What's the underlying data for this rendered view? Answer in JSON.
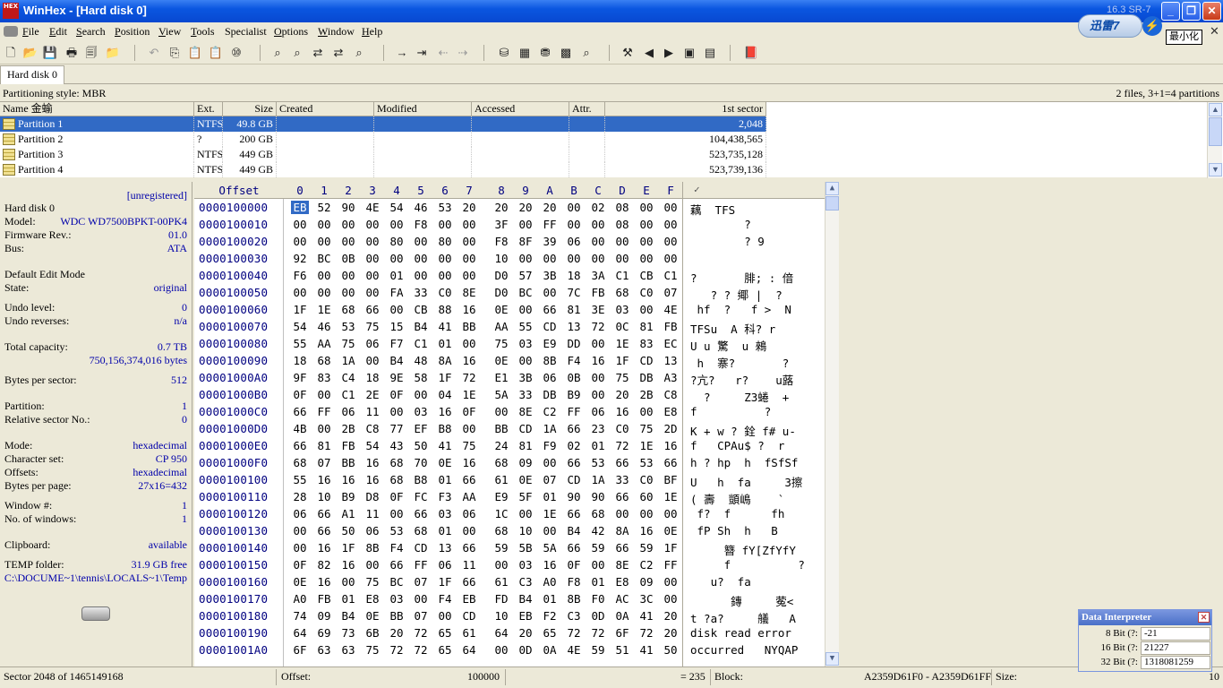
{
  "titlebar": {
    "logo": "HEX",
    "title": "WinHex - [Hard disk 0]",
    "version": "16.3 SR-7",
    "minimize": "_",
    "restore": "❐",
    "close": "✕"
  },
  "overlay": {
    "xunlei_label": "迅雷7",
    "xunlei_bolt": "⚡",
    "tooltip": "最小化",
    "doc_close": "✕"
  },
  "menu": {
    "items": [
      {
        "key": "F",
        "rest": "ile"
      },
      {
        "key": "E",
        "rest": "dit"
      },
      {
        "key": "S",
        "rest": "earch"
      },
      {
        "key": "P",
        "rest": "osition"
      },
      {
        "key": "V",
        "rest": "iew"
      },
      {
        "key": "T",
        "rest": "ools"
      },
      {
        "key": "",
        "rest": "Specialist"
      },
      {
        "key": "O",
        "rest": "ptions"
      },
      {
        "key": "W",
        "rest": "indow"
      },
      {
        "key": "H",
        "rest": "elp"
      }
    ]
  },
  "toolbar": {
    "icons": [
      "new-file-icon",
      "open-folder-icon",
      "save-icon",
      "print-icon",
      "properties-icon",
      "open-disk-icon",
      "undo-icon",
      "copy-icon",
      "paste-icon",
      "paste-special-icon",
      "hex-convert-icon",
      "find-icon",
      "find-hex-icon",
      "replace-icon",
      "replace-hex-icon",
      "find-again-icon",
      "goto-offset-icon",
      "goto-sector-icon",
      "back-icon",
      "forward-icon",
      "disk-editor-icon",
      "ram-editor-icon",
      "hdd-icon",
      "calculator-icon",
      "analyze-icon",
      "tools-icon",
      "prev-sector-icon",
      "next-sector-icon",
      "snapshot-icon",
      "template-icon",
      "help-book-icon"
    ],
    "glyphs": [
      "🗋",
      "📂",
      "💾",
      "🖶",
      "🗐",
      "📁",
      "↶",
      "⎘",
      "📋",
      "📋",
      "⑩",
      "⌕",
      "⌕",
      "⇄",
      "⇄",
      "⌕",
      "→",
      "⇥",
      "⇠",
      "⇢",
      "⛁",
      "▦",
      "⛃",
      "▩",
      "⌕",
      "⚒",
      "◀",
      "▶",
      "▣",
      "▤",
      "📕"
    ]
  },
  "tab": {
    "label": "Hard disk 0"
  },
  "infobar": {
    "partitioning_style": "Partitioning style: MBR",
    "files_count": "2 files, 3+1=4 partitions"
  },
  "partitions": {
    "headers": {
      "name": "Name 金蝓",
      "ext": "Ext.",
      "size": "Size",
      "created": "Created",
      "modified": "Modified",
      "accessed": "Accessed",
      "attr": "Attr.",
      "first_sector": "1st sector"
    },
    "rows": [
      {
        "name": "Partition 1",
        "ext": "NTFS",
        "size": "49.8 GB",
        "first_sector": "2,048"
      },
      {
        "name": "Partition 2",
        "ext": "?",
        "size": "200 GB",
        "first_sector": "104,438,565"
      },
      {
        "name": "Partition 3",
        "ext": "NTFS",
        "size": "449 GB",
        "first_sector": "523,735,128"
      },
      {
        "name": "Partition 4",
        "ext": "NTFS",
        "size": "449 GB",
        "first_sector": "523,739,136"
      }
    ]
  },
  "info": {
    "unregistered": "[unregistered]",
    "disk_name": "Hard disk 0",
    "model_label": "Model:",
    "model": "WDC WD7500BPKT-00PK4",
    "firmware_label": "Firmware Rev.:",
    "firmware": "01.0",
    "bus_label": "Bus:",
    "bus": "ATA",
    "edit_mode": "Default Edit Mode",
    "state_label": "State:",
    "state": "original",
    "undo_level_label": "Undo level:",
    "undo_level": "0",
    "undo_reverses_label": "Undo reverses:",
    "undo_reverses": "n/a",
    "total_capacity_label": "Total capacity:",
    "total_capacity": "0.7 TB",
    "total_bytes": "750,156,374,016 bytes",
    "bytes_per_sector_label": "Bytes per sector:",
    "bytes_per_sector": "512",
    "partition_label": "Partition:",
    "partition": "1",
    "relative_sector_label": "Relative sector No.:",
    "relative_sector": "0",
    "mode_label": "Mode:",
    "mode": "hexadecimal",
    "charset_label": "Character set:",
    "charset": "CP 950",
    "offsets_label": "Offsets:",
    "offsets": "hexadecimal",
    "bytes_per_page_label": "Bytes per page:",
    "bytes_per_page": "27x16=432",
    "window_no_label": "Window #:",
    "window_no": "1",
    "no_windows_label": "No. of windows:",
    "no_windows": "1",
    "clipboard_label": "Clipboard:",
    "clipboard": "available",
    "temp_folder_label": "TEMP folder:",
    "temp_free": "31.9 GB free",
    "temp_path": "C:\\DOCUME~1\\tennis\\LOCALS~1\\Temp"
  },
  "hex": {
    "offset_label": "Offset",
    "columns": [
      "0",
      "1",
      "2",
      "3",
      "4",
      "5",
      "6",
      "7",
      "8",
      "9",
      "A",
      "B",
      "C",
      "D",
      "E",
      "F"
    ],
    "text_header": "✓",
    "rows": [
      {
        "offset": "0000100000",
        "bytes": [
          "EB",
          "52",
          "90",
          "4E",
          "54",
          "46",
          "53",
          "20",
          "20",
          "20",
          "20",
          "00",
          "02",
          "08",
          "00",
          "00"
        ],
        "text": "藕  TFS"
      },
      {
        "offset": "0000100010",
        "bytes": [
          "00",
          "00",
          "00",
          "00",
          "00",
          "F8",
          "00",
          "00",
          "3F",
          "00",
          "FF",
          "00",
          "00",
          "08",
          "00",
          "00"
        ],
        "text": "        ?"
      },
      {
        "offset": "0000100020",
        "bytes": [
          "00",
          "00",
          "00",
          "00",
          "80",
          "00",
          "80",
          "00",
          "F8",
          "8F",
          "39",
          "06",
          "00",
          "00",
          "00",
          "00"
        ],
        "text": "        ? 9"
      },
      {
        "offset": "0000100030",
        "bytes": [
          "92",
          "BC",
          "0B",
          "00",
          "00",
          "00",
          "00",
          "00",
          "10",
          "00",
          "00",
          "00",
          "00",
          "00",
          "00",
          "00"
        ],
        "text": ""
      },
      {
        "offset": "0000100040",
        "bytes": [
          "F6",
          "00",
          "00",
          "00",
          "01",
          "00",
          "00",
          "00",
          "D0",
          "57",
          "3B",
          "18",
          "3A",
          "C1",
          "CB",
          "C1"
        ],
        "text": "?       腓; : 偣"
      },
      {
        "offset": "0000100050",
        "bytes": [
          "00",
          "00",
          "00",
          "00",
          "FA",
          "33",
          "C0",
          "8E",
          "D0",
          "BC",
          "00",
          "7C",
          "FB",
          "68",
          "C0",
          "07"
        ],
        "text": "   ? ? 鄊 |  ?"
      },
      {
        "offset": "0000100060",
        "bytes": [
          "1F",
          "1E",
          "68",
          "66",
          "00",
          "CB",
          "88",
          "16",
          "0E",
          "00",
          "66",
          "81",
          "3E",
          "03",
          "00",
          "4E"
        ],
        "text": " hf  ?   f >  N"
      },
      {
        "offset": "0000100070",
        "bytes": [
          "54",
          "46",
          "53",
          "75",
          "15",
          "B4",
          "41",
          "BB",
          "AA",
          "55",
          "CD",
          "13",
          "72",
          "0C",
          "81",
          "FB"
        ],
        "text": "TFSu  A 科? r"
      },
      {
        "offset": "0000100080",
        "bytes": [
          "55",
          "AA",
          "75",
          "06",
          "F7",
          "C1",
          "01",
          "00",
          "75",
          "03",
          "E9",
          "DD",
          "00",
          "1E",
          "83",
          "EC"
        ],
        "text": "U u 驚  u 鶆"
      },
      {
        "offset": "0000100090",
        "bytes": [
          "18",
          "68",
          "1A",
          "00",
          "B4",
          "48",
          "8A",
          "16",
          "0E",
          "00",
          "8B",
          "F4",
          "16",
          "1F",
          "CD",
          "13"
        ],
        "text": " h  寨?       ?"
      },
      {
        "offset": "00001000A0",
        "bytes": [
          "9F",
          "83",
          "C4",
          "18",
          "9E",
          "58",
          "1F",
          "72",
          "E1",
          "3B",
          "06",
          "0B",
          "00",
          "75",
          "DB",
          "A3"
        ],
        "text": "?亢?   r?    u蕗"
      },
      {
        "offset": "00001000B0",
        "bytes": [
          "0F",
          "00",
          "C1",
          "2E",
          "0F",
          "00",
          "04",
          "1E",
          "5A",
          "33",
          "DB",
          "B9",
          "00",
          "20",
          "2B",
          "C8"
        ],
        "text": "  ?     Z3蜷  +"
      },
      {
        "offset": "00001000C0",
        "bytes": [
          "66",
          "FF",
          "06",
          "11",
          "00",
          "03",
          "16",
          "0F",
          "00",
          "8E",
          "C2",
          "FF",
          "06",
          "16",
          "00",
          "E8"
        ],
        "text": "f          ?"
      },
      {
        "offset": "00001000D0",
        "bytes": [
          "4B",
          "00",
          "2B",
          "C8",
          "77",
          "EF",
          "B8",
          "00",
          "BB",
          "CD",
          "1A",
          "66",
          "23",
          "C0",
          "75",
          "2D"
        ],
        "text": "K + w ? 銓 f# u-"
      },
      {
        "offset": "00001000E0",
        "bytes": [
          "66",
          "81",
          "FB",
          "54",
          "43",
          "50",
          "41",
          "75",
          "24",
          "81",
          "F9",
          "02",
          "01",
          "72",
          "1E",
          "16"
        ],
        "text": "f   CPAu$ ?  r"
      },
      {
        "offset": "00001000F0",
        "bytes": [
          "68",
          "07",
          "BB",
          "16",
          "68",
          "70",
          "0E",
          "16",
          "68",
          "09",
          "00",
          "66",
          "53",
          "66",
          "53",
          "66"
        ],
        "text": "h ? hp  h  fSfSf"
      },
      {
        "offset": "0000100100",
        "bytes": [
          "55",
          "16",
          "16",
          "16",
          "68",
          "B8",
          "01",
          "66",
          "61",
          "0E",
          "07",
          "CD",
          "1A",
          "33",
          "C0",
          "BF"
        ],
        "text": "U   h  fa     3擦"
      },
      {
        "offset": "0000100110",
        "bytes": [
          "28",
          "10",
          "B9",
          "D8",
          "0F",
          "FC",
          "F3",
          "AA",
          "E9",
          "5F",
          "01",
          "90",
          "90",
          "66",
          "60",
          "1E"
        ],
        "text": "( 壽  顗嶋    `"
      },
      {
        "offset": "0000100120",
        "bytes": [
          "06",
          "66",
          "A1",
          "11",
          "00",
          "66",
          "03",
          "06",
          "1C",
          "00",
          "1E",
          "66",
          "68",
          "00",
          "00",
          "00"
        ],
        "text": " f?  f      fh"
      },
      {
        "offset": "0000100130",
        "bytes": [
          "00",
          "66",
          "50",
          "06",
          "53",
          "68",
          "01",
          "00",
          "68",
          "10",
          "00",
          "B4",
          "42",
          "8A",
          "16",
          "0E"
        ],
        "text": " fP Sh  h   B"
      },
      {
        "offset": "0000100140",
        "bytes": [
          "00",
          "16",
          "1F",
          "8B",
          "F4",
          "CD",
          "13",
          "66",
          "59",
          "5B",
          "5A",
          "66",
          "59",
          "66",
          "59",
          "1F"
        ],
        "text": "     簪 fY[ZfYfY"
      },
      {
        "offset": "0000100150",
        "bytes": [
          "0F",
          "82",
          "16",
          "00",
          "66",
          "FF",
          "06",
          "11",
          "00",
          "03",
          "16",
          "0F",
          "00",
          "8E",
          "C2",
          "FF"
        ],
        "text": "     f          ?"
      },
      {
        "offset": "0000100160",
        "bytes": [
          "0E",
          "16",
          "00",
          "75",
          "BC",
          "07",
          "1F",
          "66",
          "61",
          "C3",
          "A0",
          "F8",
          "01",
          "E8",
          "09",
          "00"
        ],
        "text": "   u?  fa"
      },
      {
        "offset": "0000100170",
        "bytes": [
          "A0",
          "FB",
          "01",
          "E8",
          "03",
          "00",
          "F4",
          "EB",
          "FD",
          "B4",
          "01",
          "8B",
          "F0",
          "AC",
          "3C",
          "00"
        ],
        "text": "      鏄     蒬<"
      },
      {
        "offset": "0000100180",
        "bytes": [
          "74",
          "09",
          "B4",
          "0E",
          "BB",
          "07",
          "00",
          "CD",
          "10",
          "EB",
          "F2",
          "C3",
          "0D",
          "0A",
          "41",
          "20"
        ],
        "text": "t ?a?     艤   A"
      },
      {
        "offset": "0000100190",
        "bytes": [
          "64",
          "69",
          "73",
          "6B",
          "20",
          "72",
          "65",
          "61",
          "64",
          "20",
          "65",
          "72",
          "72",
          "6F",
          "72",
          "20"
        ],
        "text": "disk read error"
      },
      {
        "offset": "00001001A0",
        "bytes": [
          "6F",
          "63",
          "63",
          "75",
          "72",
          "72",
          "65",
          "64",
          "00",
          "0D",
          "0A",
          "4E",
          "59",
          "51",
          "41",
          "50"
        ],
        "text": "occurred   NYQAP"
      }
    ]
  },
  "interpreter": {
    "title": "Data Interpreter",
    "close": "✕",
    "bit8_label": "8 Bit (?:",
    "bit8": "-21",
    "bit16_label": "16 Bit (?:",
    "bit16": "21227",
    "bit32_label": "32 Bit (?:",
    "bit32": "1318081259"
  },
  "status": {
    "sector": "Sector 2048 of 1465149168",
    "offset_label": "Offset:",
    "offset_value": "100000",
    "byte_value": "= 235",
    "block_label": "Block:",
    "block_range": "A2359D61F0 - A2359D61FF",
    "size_label": "Size:",
    "size_value": "10"
  }
}
